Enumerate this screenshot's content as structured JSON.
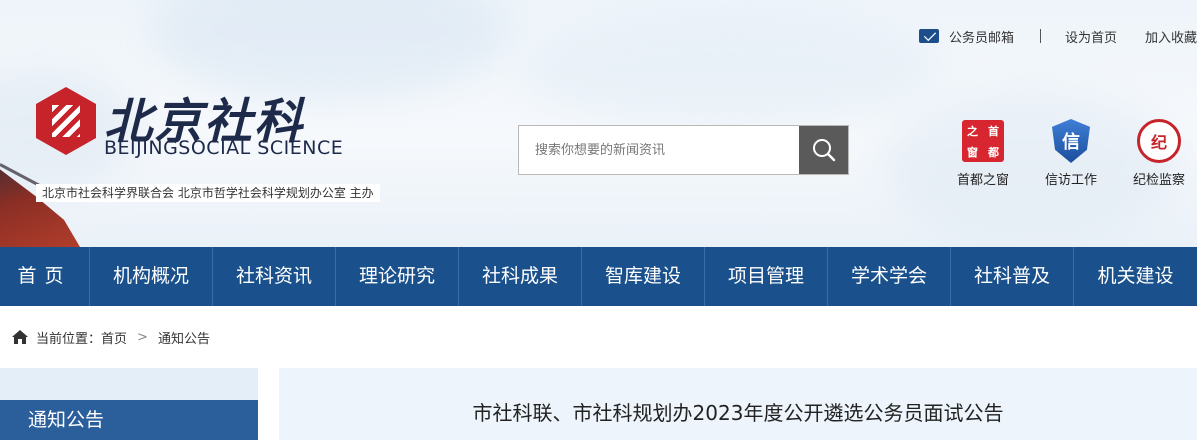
{
  "top_links": {
    "mail": "公务员邮箱",
    "set_home": "设为首页",
    "favorite": "加入收藏"
  },
  "logo": {
    "name_cn": "北京社科",
    "name_en": "BEIJINGSOCIAL SCIENCE",
    "sponsor": "北京市社会科学界联合会  北京市哲学社会科学规划办公室 主办"
  },
  "search": {
    "placeholder": "搜索你想要的新闻资讯"
  },
  "quick_links": [
    {
      "label": "首都之窗",
      "icon": "capital-window-icon",
      "glyphs": [
        "之",
        "首",
        "窗",
        "都"
      ]
    },
    {
      "label": "信访工作",
      "icon": "petition-shield-icon",
      "glyph": "信"
    },
    {
      "label": "纪检监察",
      "icon": "discipline-seal-icon",
      "glyph": "纪"
    }
  ],
  "nav": [
    "首页",
    "机构概况",
    "社科资讯",
    "理论研究",
    "社科成果",
    "智库建设",
    "项目管理",
    "学术学会",
    "社科普及",
    "机关建设"
  ],
  "breadcrumb": {
    "prefix": "当前位置：",
    "home": "首页",
    "current": "通知公告"
  },
  "sidebar": {
    "title": "通知公告"
  },
  "article": {
    "title": "市社科联、市社科规划办2023年度公开遴选公务员面试公告"
  },
  "colors": {
    "nav_bg": "#1a508b",
    "sidebar_head": "#2a5f9b",
    "accent_red": "#c6232a"
  }
}
